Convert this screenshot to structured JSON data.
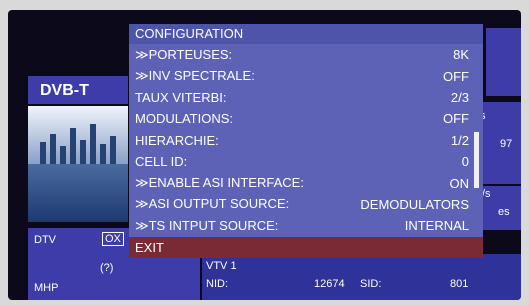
{
  "background": {
    "left_label": "DVB-T",
    "dtv_label": "DTV",
    "dtv_box": "OX",
    "question": "(?)",
    "mhp_label": "MHP",
    "right_97": "97",
    "right_s": "/s",
    "right_es": "es",
    "right_small_s": "s",
    "channel_name": "VTV 1",
    "nid_label": "NID:",
    "nid_value": "12674",
    "sid_label": "SID:",
    "sid_value": "801"
  },
  "menu": {
    "title": "CONFIGURATION",
    "items": [
      {
        "label": "≫PORTEUSES:",
        "value": "8K"
      },
      {
        "label": "≫INV SPECTRALE:",
        "value": "OFF"
      },
      {
        "label": "TAUX VITERBI:",
        "value": "2/3"
      },
      {
        "label": "MODULATIONS:",
        "value": "OFF"
      },
      {
        "label": "HIERARCHIE:",
        "value": "1/2"
      },
      {
        "label": "CELL ID:",
        "value": "0"
      },
      {
        "label": "≫ENABLE ASI INTERFACE:",
        "value": "ON"
      },
      {
        "label": "≫ASI OUTPUT SOURCE:",
        "value": "DEMODULATORS"
      },
      {
        "label": "≫TS INTPUT SOURCE:",
        "value": "INTERNAL"
      }
    ],
    "exit_label": "EXIT"
  },
  "colors": {
    "menu_bg": "#5d62b6",
    "exit_bg": "#7a2a34",
    "panel_bg": "#3d3ca8"
  }
}
